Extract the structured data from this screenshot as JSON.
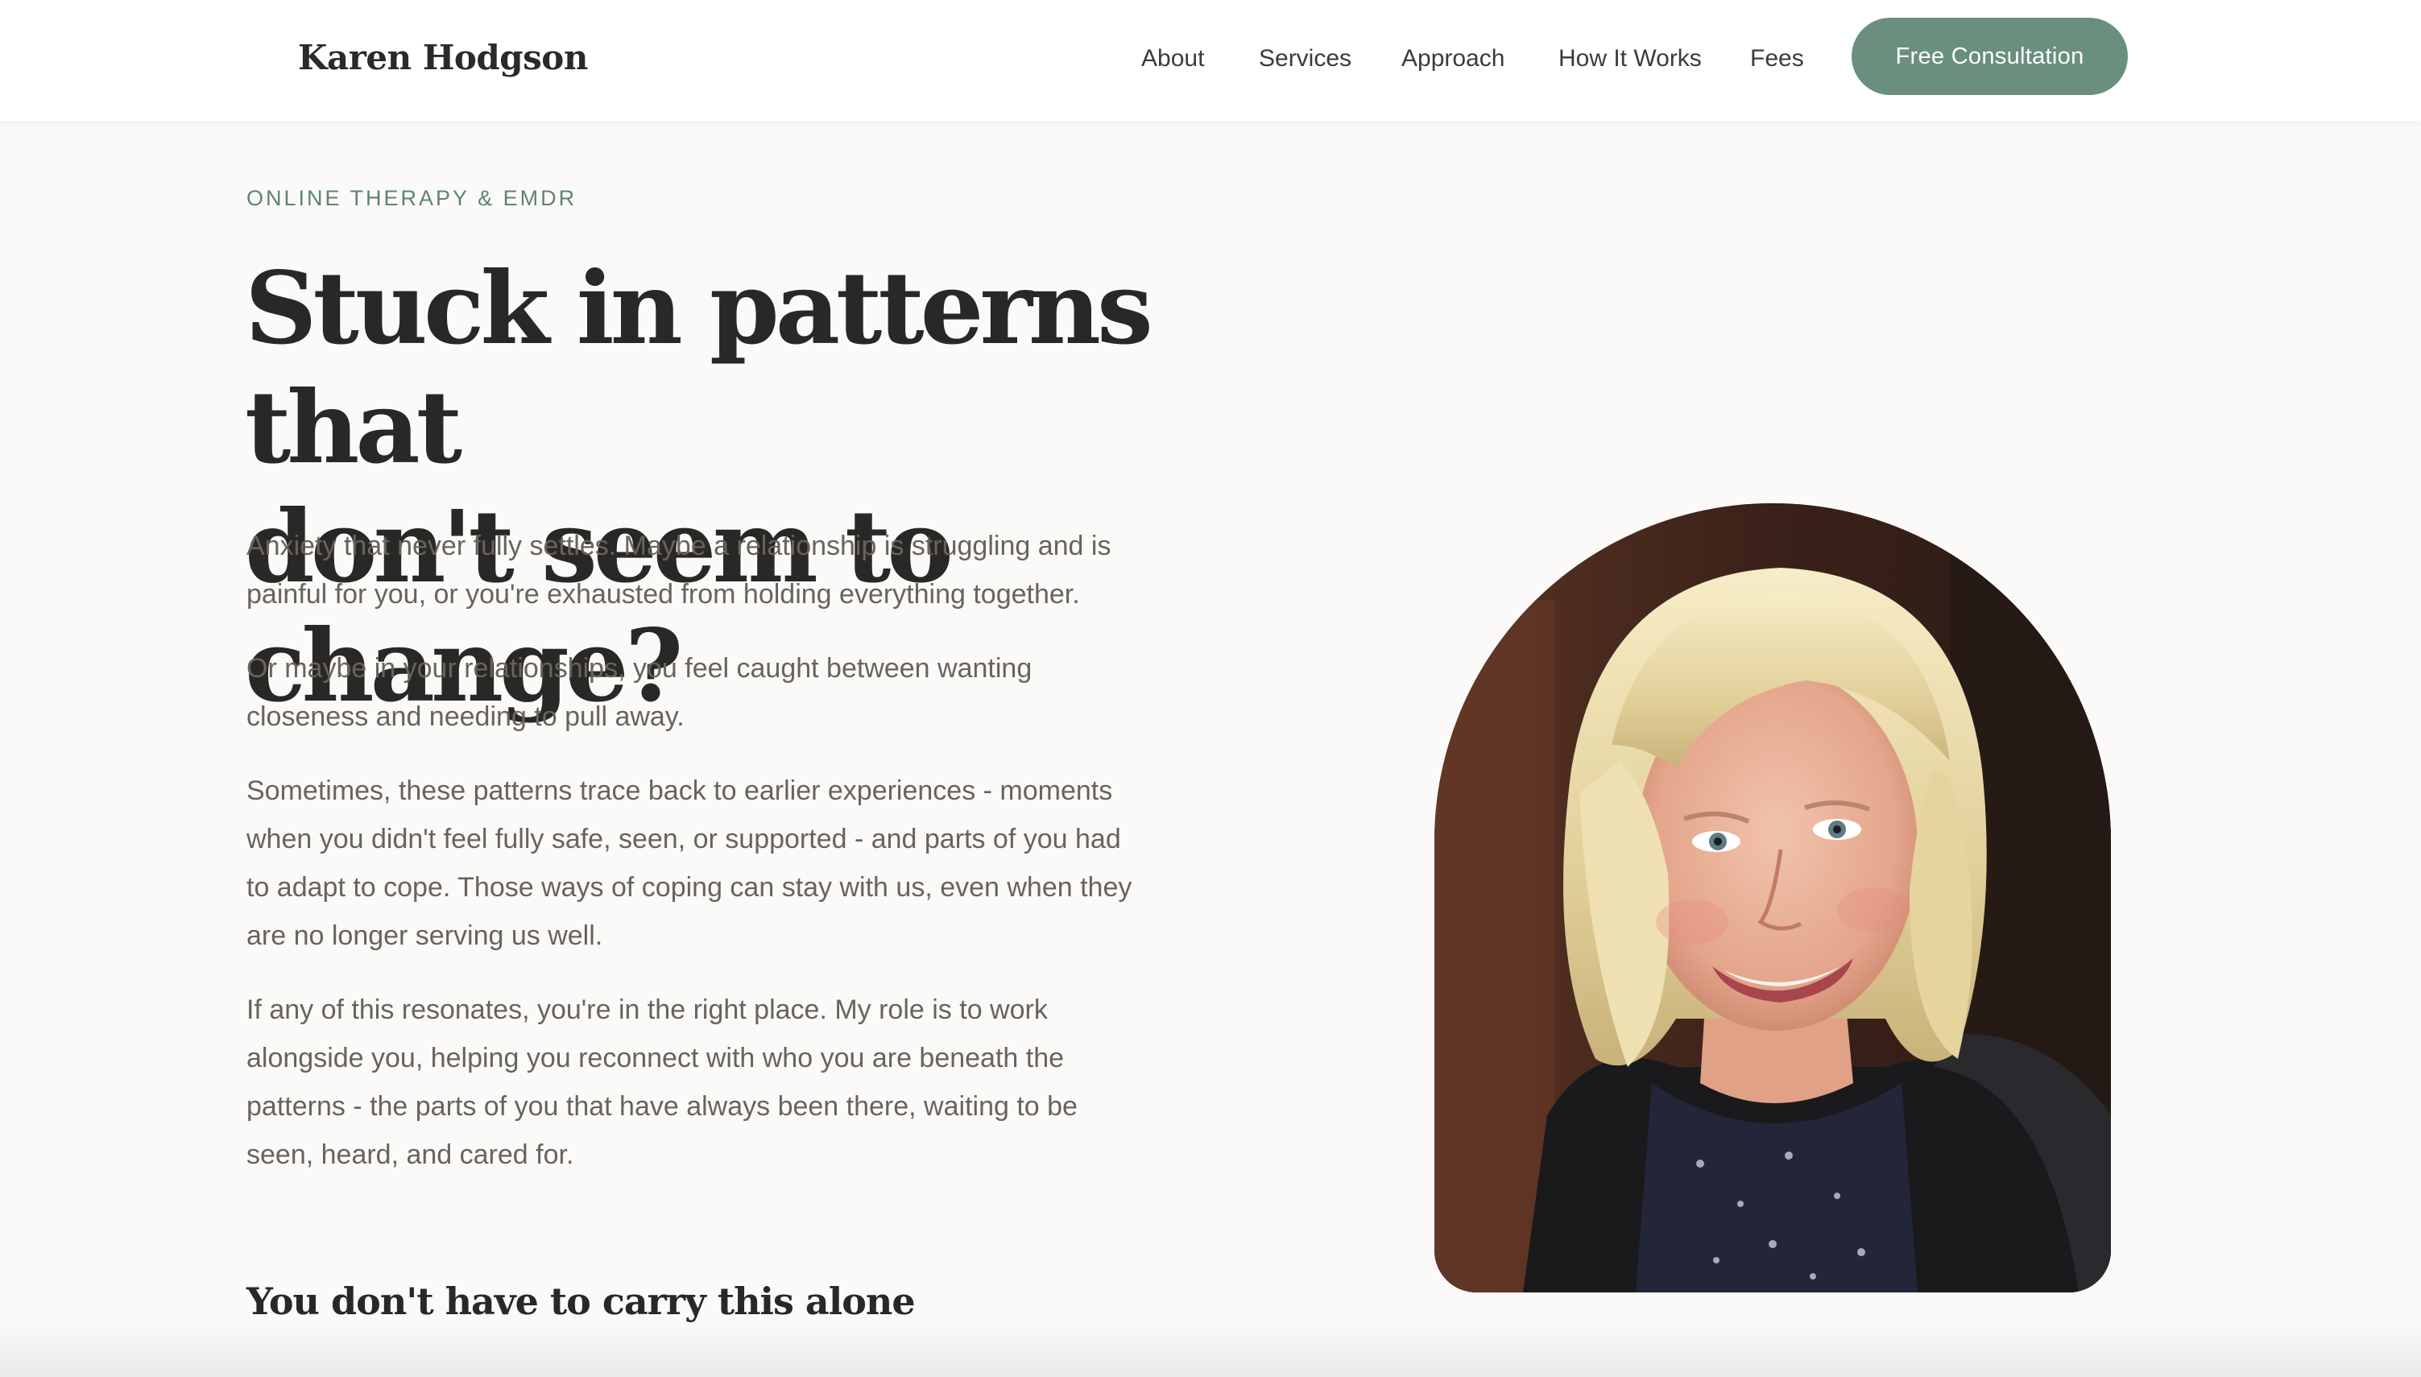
{
  "header": {
    "brand": "Karen Hodgson",
    "nav": [
      {
        "label": "About"
      },
      {
        "label": "Services"
      },
      {
        "label": "Approach"
      },
      {
        "label": "How It Works"
      },
      {
        "label": "Fees"
      }
    ],
    "cta_label": "Free Consultation"
  },
  "hero": {
    "eyebrow": "ONLINE THERAPY & EMDR",
    "title_line1": "Stuck in patterns that",
    "title_line2": "don't seem to change?",
    "paragraphs": [
      "Anxiety that never fully settles. Maybe a relationship is struggling and is painful for you, or you're exhausted from holding everything together.",
      "Or maybe in your relationships, you feel caught between wanting closeness and needing to pull away.",
      "Sometimes, these patterns trace back to earlier experiences - moments when you didn't feel fully safe, seen, or supported - and parts of you had to adapt to cope. Those ways of coping can stay with us, even when they are no longer serving us well.",
      "If any of this resonates, you're in the right place. My role is to work alongside you, helping you reconnect with who you are beneath the patterns - the parts of you that have always been there, waiting to be seen, heard, and cared for."
    ],
    "subheading": "You don't have to carry this alone"
  },
  "colors": {
    "accent": "#6a8f7f",
    "eyebrow": "#5d8472",
    "heading": "#2a2826",
    "body": "#67635e",
    "background": "#fcfaf8"
  },
  "icons": {
    "portrait": "therapist-portrait-photo"
  }
}
